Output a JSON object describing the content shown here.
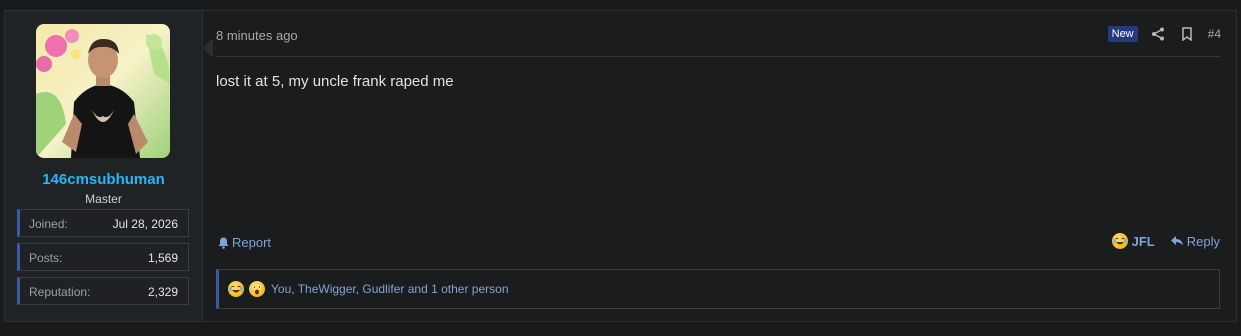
{
  "user": {
    "username": "146cmsubhuman",
    "title": "Master",
    "stats": [
      {
        "label": "Joined:",
        "value": "Jul 28, 2026"
      },
      {
        "label": "Posts:",
        "value": "1,569"
      },
      {
        "label": "Reputation:",
        "value": "2,329"
      }
    ]
  },
  "post": {
    "time": "8 minutes ago",
    "badge": "New",
    "number": "#4",
    "message": "lost it at 5, my uncle frank raped me"
  },
  "actions": {
    "report": "Report",
    "reaction_label": "JFL",
    "reply": "Reply"
  },
  "reactions": {
    "summary": "You, TheWigger, Gudlifer and 1 other person"
  },
  "colors": {
    "username": "#29b6f6",
    "link": "#7da5d8",
    "badge": "#253a7c",
    "accent_border": "#3b5ba0"
  }
}
